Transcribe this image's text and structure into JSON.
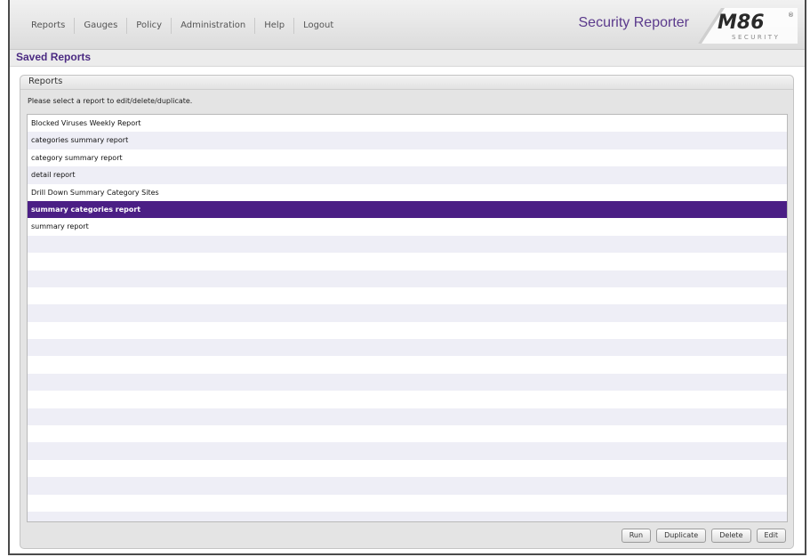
{
  "nav": {
    "items": [
      {
        "label": "Reports"
      },
      {
        "label": "Gauges"
      },
      {
        "label": "Policy"
      },
      {
        "label": "Administration"
      },
      {
        "label": "Help"
      },
      {
        "label": "Logout"
      }
    ]
  },
  "header": {
    "app_title": "Security Reporter",
    "logo_text": "M86",
    "logo_subtext": "SECURITY",
    "logo_mark": "®"
  },
  "page": {
    "title": "Saved Reports"
  },
  "panel": {
    "title": "Reports",
    "instruction": "Please select a report to edit/delete/duplicate."
  },
  "reports": {
    "items": [
      {
        "label": "Blocked Viruses Weekly Report",
        "selected": false
      },
      {
        "label": "categories summary report",
        "selected": false
      },
      {
        "label": "category summary report",
        "selected": false
      },
      {
        "label": "detail report",
        "selected": false
      },
      {
        "label": "Drill Down Summary Category Sites",
        "selected": false
      },
      {
        "label": "summary categories report",
        "selected": true
      },
      {
        "label": "summary report",
        "selected": false
      }
    ]
  },
  "buttons": {
    "run": "Run",
    "duplicate": "Duplicate",
    "delete": "Delete",
    "edit": "Edit"
  },
  "colors": {
    "brand_purple": "#4b1f85",
    "title_purple": "#5b3a8c"
  }
}
